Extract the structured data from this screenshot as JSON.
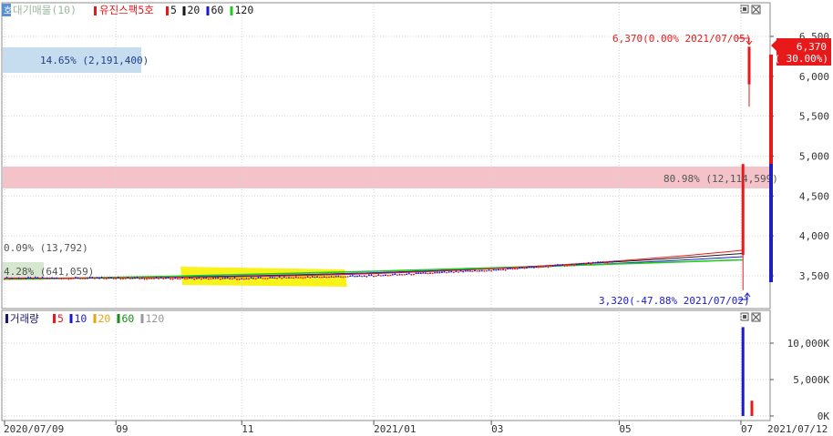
{
  "price_panel": {
    "legend": {
      "marker_label": "호",
      "overlay_label": "대기매물(10)",
      "stock_name": "유진스팩5호",
      "ma": [
        {
          "label": "5",
          "color": "#e8191b"
        },
        {
          "label": "20",
          "color": "#1a1a1a"
        },
        {
          "label": "60",
          "color": "#1a1acc"
        },
        {
          "label": "120",
          "color": "#1fcc1f"
        }
      ]
    },
    "zone_labels": [
      {
        "text": "14.65% (2,191,400)",
        "pct": 14.65
      },
      {
        "text": "80.98% (12,114,599)",
        "pct": 80.98
      },
      {
        "text": "0.09% (13,792)",
        "pct": 0.09
      },
      {
        "text": "4.28% (641,059)",
        "pct": 4.28
      }
    ],
    "high_annotation": "6,370(0.00% 2021/07/05)",
    "low_annotation": "3,320(-47.88% 2021/07/02)",
    "current_price_badge": {
      "price": "6,370",
      "change": "( 30.00%)"
    }
  },
  "volume_panel": {
    "legend": {
      "title": "거래량",
      "ma": [
        {
          "label": "5",
          "color": "#e8191b"
        },
        {
          "label": "10",
          "color": "#1a1acc"
        },
        {
          "label": "20",
          "color": "#e8a317"
        },
        {
          "label": "60",
          "color": "#1a8c1a"
        },
        {
          "label": "120",
          "color": "#999999"
        }
      ]
    }
  },
  "chart_data": {
    "type": "candlestick",
    "price_axis": {
      "ticks": [
        "6,500",
        "6,000",
        "5,500",
        "5,000",
        "4,500",
        "4,000",
        "3,500"
      ],
      "ylim": [
        3200,
        6650
      ]
    },
    "volume_axis": {
      "ticks": [
        "10,000K",
        "5,000K",
        "0K"
      ],
      "ylim": [
        0,
        13500000
      ]
    },
    "x_axis": {
      "ticks": [
        "2020/07/09",
        "09",
        "11",
        "2021/01",
        "03",
        "05",
        "07",
        "2021/07/12"
      ]
    },
    "price_series": [
      {
        "date": "2020/07/09",
        "close": 3470
      },
      {
        "date": "2020/09/01",
        "close": 3470
      },
      {
        "date": "2020/11/01",
        "close": 3465
      },
      {
        "date": "2021/01/04",
        "close": 3500
      },
      {
        "date": "2021/03/02",
        "close": 3570
      },
      {
        "date": "2021/05/03",
        "close": 3680
      },
      {
        "date": "2021/07/02",
        "open": 3760,
        "high": 4900,
        "low": 3320,
        "close": 4900
      },
      {
        "date": "2021/07/05",
        "open": 5900,
        "high": 6370,
        "low": 5620,
        "close": 6370
      }
    ],
    "volume_series": [
      {
        "date": "2021/07/02",
        "volume": 12200000
      },
      {
        "date": "2021/07/05",
        "volume": 2100000
      }
    ],
    "volume_profile": [
      {
        "price_range": [
          6000,
          6370
        ],
        "pct": 14.65,
        "volume": 2191400
      },
      {
        "price_range": [
          4600,
          4900
        ],
        "pct": 80.98,
        "volume": 12114599
      },
      {
        "price_range": [
          3760,
          3790
        ],
        "pct": 0.09,
        "volume": 13792
      },
      {
        "price_range": [
          3440,
          3500
        ],
        "pct": 4.28,
        "volume": 641059
      }
    ]
  }
}
